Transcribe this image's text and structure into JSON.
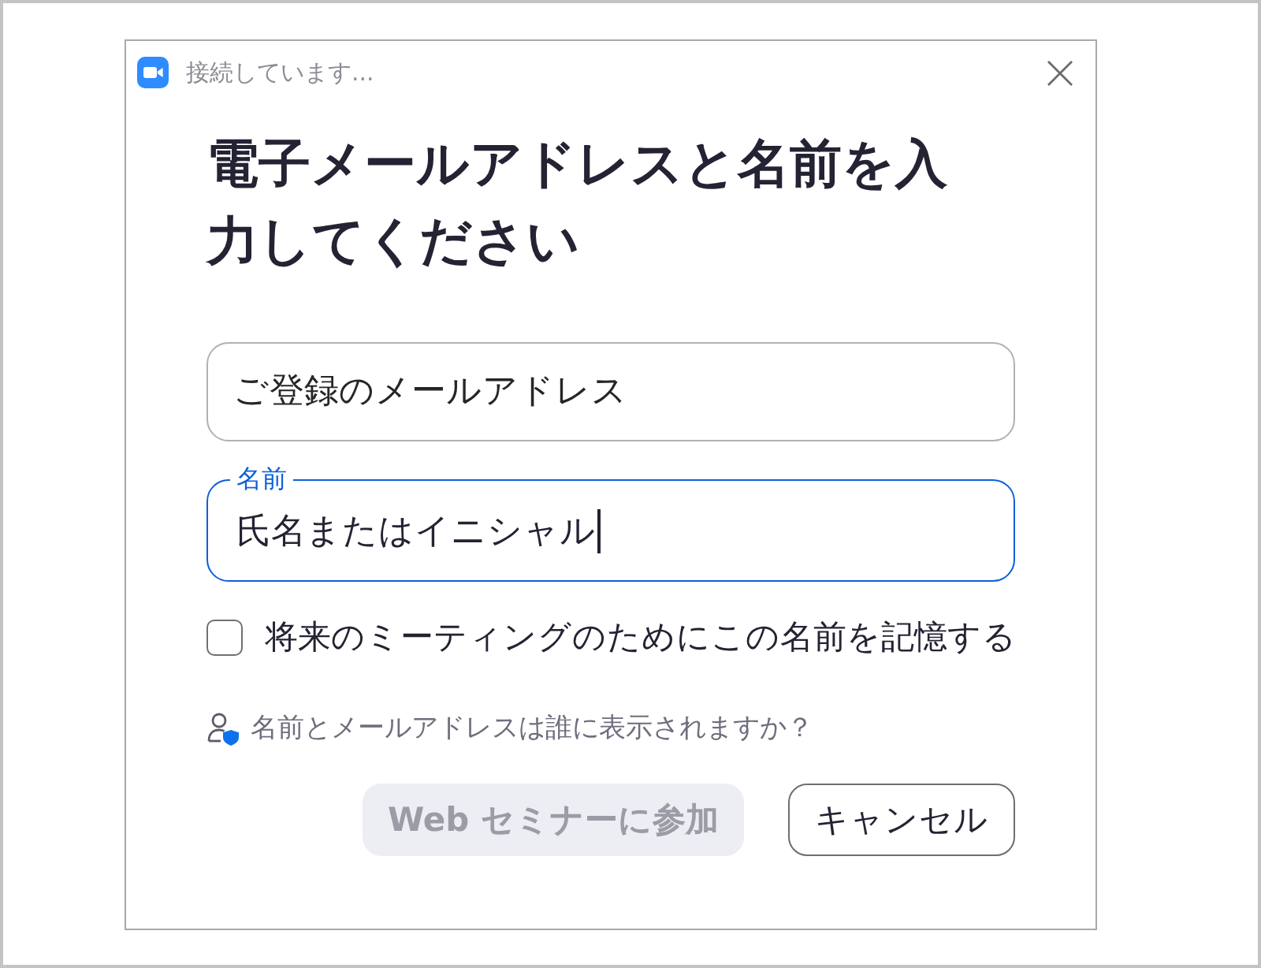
{
  "window": {
    "title": "接続しています..."
  },
  "heading": "電子メールアドレスと名前を入力してください",
  "fields": [
    {
      "placeholder": "ご登録のメールアドレス",
      "focused": false
    },
    {
      "label": "名前",
      "value": "氏名またはイニシャル",
      "focused": true
    }
  ],
  "remember": {
    "label": "将来のミーティングのためにこの名前を記憶する",
    "checked": false
  },
  "privacy_link": {
    "text": "名前とメールアドレスは誰に表示されますか？"
  },
  "buttons": [
    {
      "label": "Web セミナーに参加",
      "disabled": true
    },
    {
      "label": "キャンセル",
      "disabled": false
    }
  ]
}
